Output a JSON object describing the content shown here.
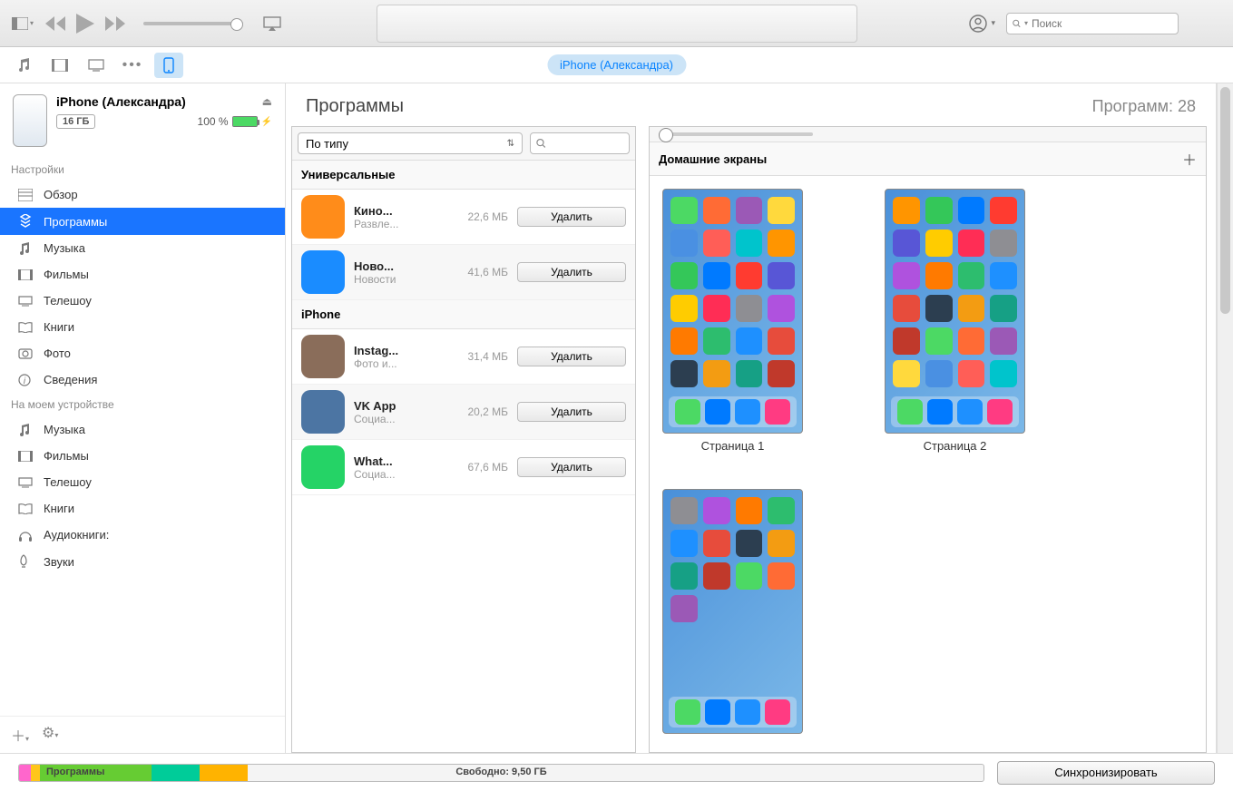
{
  "window": {
    "minimize": "—",
    "maximize": "☐",
    "close": "✕"
  },
  "search": {
    "placeholder": "Поиск"
  },
  "device_pill": "iPhone (Александра)",
  "device": {
    "name": "iPhone (Александра)",
    "storage": "16 ГБ",
    "battery_text": "100 %",
    "battery_pct": 100
  },
  "sidebar": {
    "section_settings": "Настройки",
    "section_on_device": "На моем устройстве",
    "settings_items": [
      {
        "label": "Обзор",
        "icon": "overview"
      },
      {
        "label": "Программы",
        "icon": "apps",
        "selected": true
      },
      {
        "label": "Музыка",
        "icon": "music"
      },
      {
        "label": "Фильмы",
        "icon": "movies"
      },
      {
        "label": "Телешоу",
        "icon": "tv"
      },
      {
        "label": "Книги",
        "icon": "books"
      },
      {
        "label": "Фото",
        "icon": "photos"
      },
      {
        "label": "Сведения",
        "icon": "info"
      }
    ],
    "device_items": [
      {
        "label": "Музыка",
        "icon": "music"
      },
      {
        "label": "Фильмы",
        "icon": "movies"
      },
      {
        "label": "Телешоу",
        "icon": "tv"
      },
      {
        "label": "Книги",
        "icon": "books"
      },
      {
        "label": "Аудиокниги:",
        "icon": "audiobooks"
      },
      {
        "label": "Звуки",
        "icon": "tones"
      }
    ]
  },
  "page": {
    "title": "Программы",
    "count_label": "Программ: 28"
  },
  "apps_panel": {
    "sort_label": "По типу",
    "delete_label": "Удалить",
    "sections": [
      {
        "title": "Универсальные",
        "apps": [
          {
            "name": "Кино...",
            "category": "Развле...",
            "size": "22,6 МБ",
            "color": "#ff8c1a"
          },
          {
            "name": "Ново...",
            "category": "Новости",
            "size": "41,6 МБ",
            "color": "#1a8cff"
          }
        ]
      },
      {
        "title": "iPhone",
        "apps": [
          {
            "name": "Instag...",
            "category": "Фото и...",
            "size": "31,4 МБ",
            "color": "#8a6d5a"
          },
          {
            "name": "VK App",
            "category": "Социа...",
            "size": "20,2 МБ",
            "color": "#4c75a3"
          },
          {
            "name": "What...",
            "category": "Социа...",
            "size": "67,6 МБ",
            "color": "#25d366"
          }
        ]
      }
    ]
  },
  "screens": {
    "header": "Домашние экраны",
    "pages": [
      "Страница 1",
      "Страница 2",
      ""
    ]
  },
  "bottom": {
    "apps_label": "Программы",
    "free_label": "Свободно: 9,50 ГБ",
    "sync_label": "Синхронизировать",
    "segments": [
      {
        "color": "#ff66cc",
        "pct": 1.2
      },
      {
        "color": "#ffc61a",
        "pct": 1.0
      },
      {
        "color": "#66cc33",
        "pct": 11.5
      },
      {
        "color": "#00cc99",
        "pct": 5.0
      },
      {
        "color": "#ffb300",
        "pct": 5.0
      }
    ]
  },
  "colors": {
    "selection": "#1a75ff",
    "accent": "#0a84ff"
  }
}
